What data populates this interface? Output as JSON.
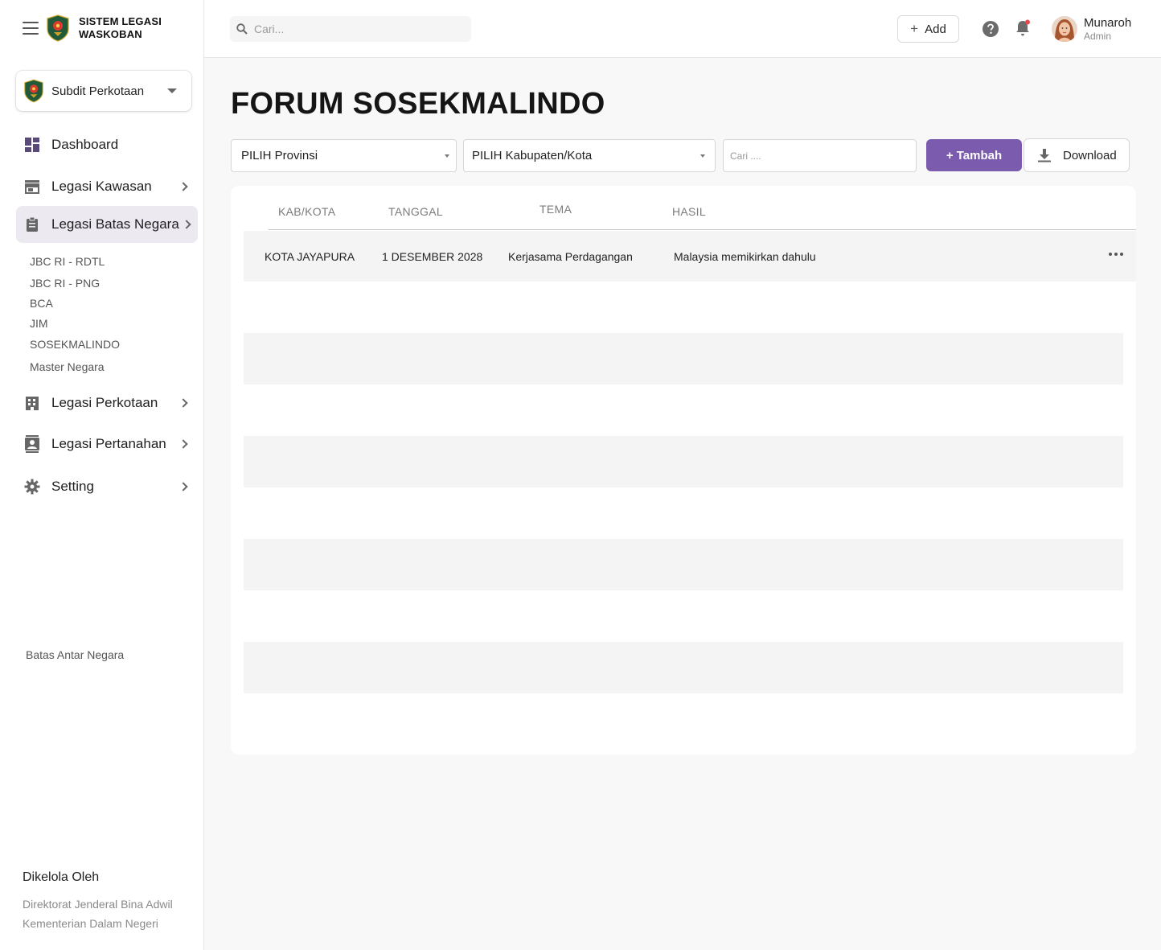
{
  "app": {
    "title_line1": "SISTEM LEGASI",
    "title_line2": "WASKOBAN"
  },
  "org_switcher": {
    "label": "Subdit Perkotaan"
  },
  "sidebar": {
    "items": [
      {
        "label": "Dashboard"
      },
      {
        "label": "Legasi Kawasan"
      },
      {
        "label": "Legasi Batas Negara"
      },
      {
        "label": "Legasi Perkotaan"
      },
      {
        "label": "Legasi Pertanahan"
      },
      {
        "label": "Setting"
      }
    ],
    "subitems": [
      {
        "label": "JBC RI - RDTL"
      },
      {
        "label": "JBC RI - PNG"
      },
      {
        "label": "BCA"
      },
      {
        "label": "JIM"
      },
      {
        "label": "SOSEKMALINDO"
      },
      {
        "label": "Master Negara"
      }
    ],
    "note": "Batas Antar Negara",
    "managed_title": "Dikelola Oleh",
    "managed_line1": "Direktorat Jenderal Bina Adwil",
    "managed_line2": "Kementerian Dalam Negeri"
  },
  "topbar": {
    "search_placeholder": "Cari...",
    "add_label": "Add",
    "user_name": "Munaroh",
    "user_role": "Admin"
  },
  "page": {
    "title": "FORUM SOSEKMALINDO",
    "province_select": "PILIH Provinsi",
    "city_select": "PILIH Kabupaten/Kota",
    "filter_placeholder": "Cari ....",
    "add_button": "+ Tambah",
    "download_button": "Download"
  },
  "table": {
    "headers": [
      "KAB/KOTA",
      "TANGGAL",
      "TEMA",
      "HASIL"
    ],
    "rows": [
      [
        "KOTA JAYAPURA",
        "1 DESEMBER 2028",
        "Kerjasama Perdagangan",
        "Malaysia memikirkan dahulu"
      ]
    ]
  },
  "colors": {
    "accent": "#7a5bae",
    "active_nav_bg": "#ece9f1",
    "notification_dot": "#e5484d"
  },
  "icons": [
    "menu-icon",
    "logo",
    "dashboard-icon",
    "store-icon",
    "clipboard-icon",
    "building-icon",
    "contact-icon",
    "gear-icon",
    "search-icon",
    "help-icon",
    "bell-icon",
    "download-icon",
    "more-icon"
  ]
}
